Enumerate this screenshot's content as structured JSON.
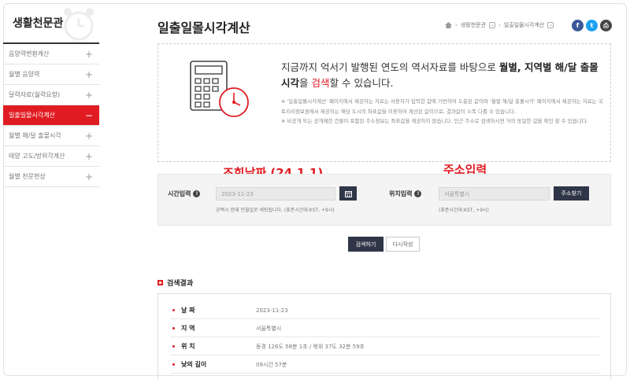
{
  "sidebar": {
    "title": "생활천문관",
    "items": [
      {
        "label": "음양력변환계산",
        "icon": "+",
        "active": false
      },
      {
        "label": "월별 음양력",
        "icon": "+",
        "active": false
      },
      {
        "label": "달력자료(월력요항)",
        "icon": "+",
        "active": false
      },
      {
        "label": "일출일몰시각계산",
        "icon": "−",
        "active": true
      },
      {
        "label": "월별 해/달 출몰시각",
        "icon": "+",
        "active": false
      },
      {
        "label": "태양 고도/방위각계산",
        "icon": "+",
        "active": false
      },
      {
        "label": "월별 천문현상",
        "icon": "+",
        "active": false
      }
    ]
  },
  "header": {
    "title": "일출일몰시각계산",
    "breadcrumb": [
      "생활천문관",
      "일출일몰시각계산"
    ],
    "share": {
      "facebook": "f",
      "twitter": "t",
      "print": "⎙"
    }
  },
  "info": {
    "lead_1": "지금까지 억서기 발행된 연도의 역서자료를 바탕으로 ",
    "lead_bold": "월별, 지역별 해/달 출몰시각",
    "lead_2": "을 ",
    "lead_link": "검색",
    "lead_3": "할 수 있습니다.",
    "note_1": "※ '일출일몰시각계산' 페이지에서 제공하는 자료는 사용자가 입력한 값에 기반하여 도출된 값이며 '월별 해/달 출몰시각' 페이지에서 제공하는 자료는 국토지리정보원에서 제공하는 해당 도시의 좌표값을 이용하여 계산된 값이므로, 결과값이 소폭 다를 수 있습니다.",
    "note_2": "※ 비공개 또는 공개제한 건물이 포함된 주소정보는 좌표값을 제공하지 않습니다. 인근 주소로 검색하시면 거의 동일한 값을 확인 할 수 있습니다."
  },
  "form": {
    "time_label": "시간입력",
    "date_value": "2023-11-23",
    "calendar_icon": "calendar-icon",
    "time_hint": "공백시 현재 민월일로 세팅됩니다. (표준시간대:KST, +9시)",
    "location_label": "위치입력",
    "location_value": "서울특별시",
    "address_button": "주소찾기",
    "location_hint": "(표준시간대:KST, +9시)"
  },
  "annotations": {
    "date_note": "조회날짜 (24.1.1)",
    "address_note": "주소입력"
  },
  "buttons": {
    "search": "검색하기",
    "reset": "다시작성"
  },
  "result": {
    "title": "검색결과",
    "rows": [
      {
        "key": "날 짜",
        "value": "2023-11-23"
      },
      {
        "key": "지 역",
        "value": "서울특별시"
      },
      {
        "key": "위 치",
        "value": "동경 126도 58분 1초 / 북위 37도 32분 59초"
      },
      {
        "key": "낮의 길이",
        "value": "09시간 57분"
      }
    ]
  },
  "colors": {
    "accent": "#e11b22",
    "dark_button": "#2f3648",
    "facebook": "#3b5998",
    "twitter": "#1da1f2",
    "print": "#444444"
  }
}
